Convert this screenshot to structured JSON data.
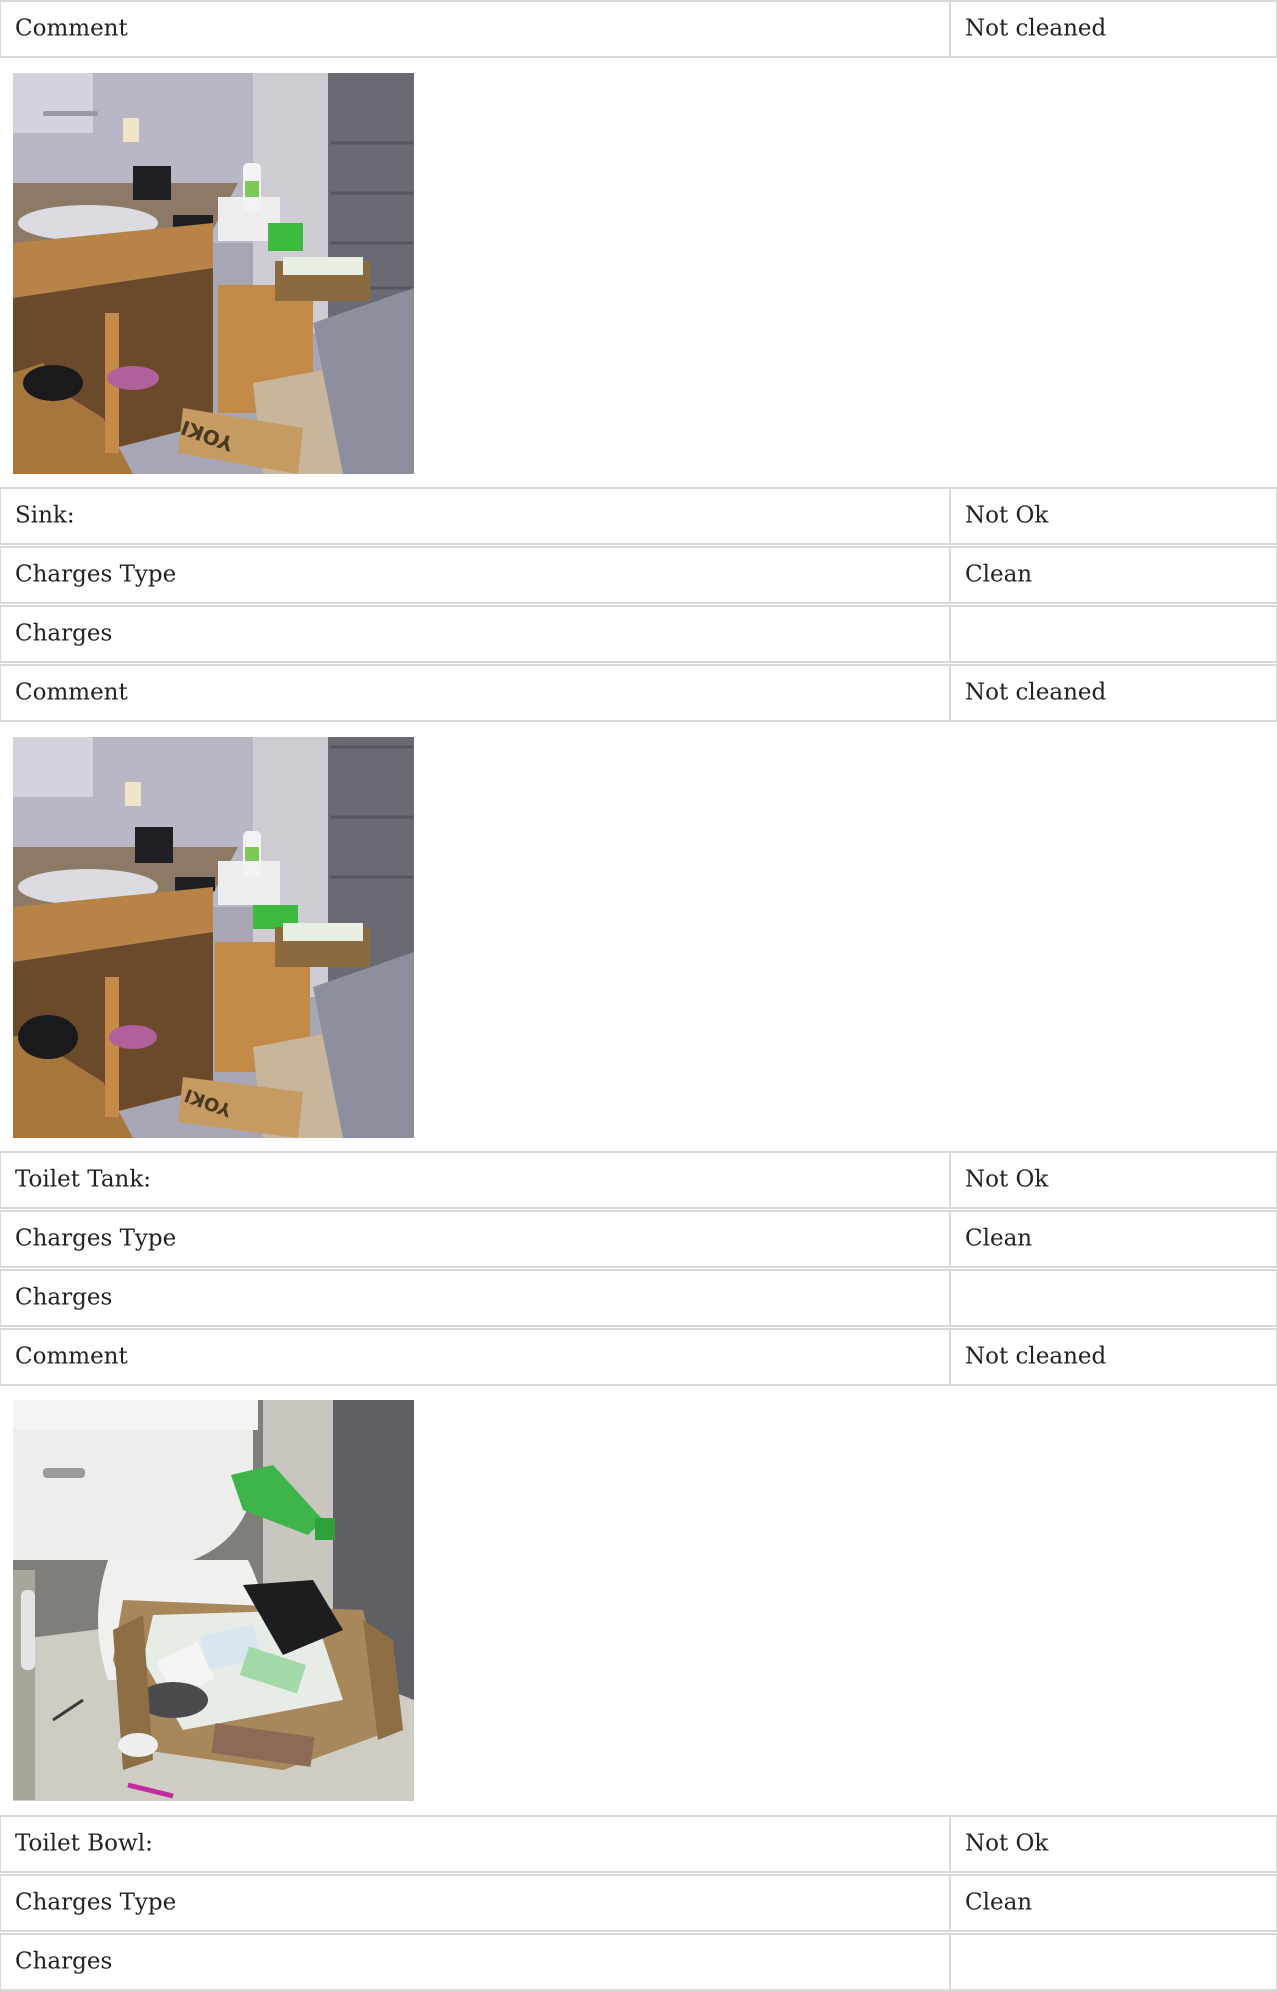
{
  "rows": [
    {
      "label": "Comment",
      "value": "Not cleaned"
    },
    {
      "label": "Sink:",
      "value": "Not Ok"
    },
    {
      "label": "Charges Type",
      "value": "Clean"
    },
    {
      "label": "Charges",
      "value": ""
    },
    {
      "label": "Comment",
      "value": "Not cleaned"
    },
    {
      "label": "Toilet Tank:",
      "value": "Not Ok"
    },
    {
      "label": "Charges Type",
      "value": "Clean"
    },
    {
      "label": "Charges",
      "value": ""
    },
    {
      "label": "Comment",
      "value": "Not cleaned"
    },
    {
      "label": "Toilet Bowl:",
      "value": "Not Ok"
    },
    {
      "label": "Charges Type",
      "value": "Clean"
    },
    {
      "label": "Charges",
      "value": ""
    }
  ],
  "photos": {
    "sink_photo_1": {
      "box_text": "YOKI"
    },
    "sink_photo_2": {
      "box_text": "YOKI"
    }
  }
}
